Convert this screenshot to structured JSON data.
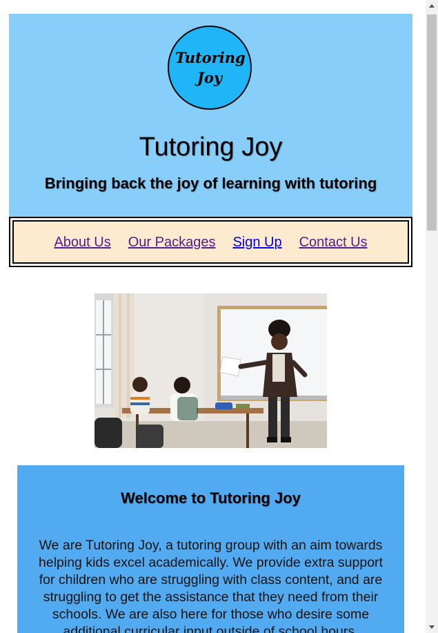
{
  "header": {
    "logo_text": "Tutoring Joy",
    "title": "Tutoring Joy",
    "tagline": "Bringing back the joy of learning with tutoring",
    "background": "#87cefa",
    "logo_color": "#1fb5f6"
  },
  "nav": {
    "items": [
      {
        "label": "About Us",
        "state": "visited"
      },
      {
        "label": "Our Packages",
        "state": "visited"
      },
      {
        "label": "Sign Up",
        "state": "unvisited"
      },
      {
        "label": "Contact Us",
        "state": "visited"
      }
    ],
    "background": "#fdebd0",
    "visited_color": "#551a8b",
    "unvisited_color": "#0000ee"
  },
  "hero": {
    "image_subject": "teacher presenting at a whiteboard to two students at desks",
    "icon": "classroom-photo"
  },
  "welcome": {
    "title": "Welcome to Tutoring Joy",
    "body": "We are Tutoring Joy, a tutoring group with an aim towards helping kids excel academically. We provide extra support for children who are struggling with class content, and are struggling to get the assistance that they need from their schools. We are also here for those who desire some additional curricular input outside of school hours.",
    "background": "#52aaf0"
  },
  "scrollbar": {
    "up_icon": "scroll-up-arrow-icon",
    "down_icon": "scroll-down-arrow-icon"
  }
}
